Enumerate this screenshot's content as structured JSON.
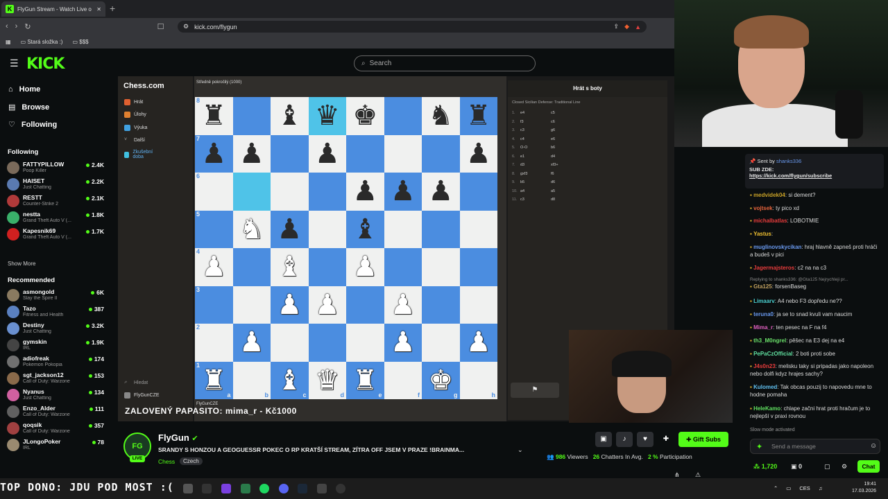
{
  "browser": {
    "tab_title": "FlyGun Stream - Watch Live o",
    "new_tab": "+",
    "url": "kick.com/flygun",
    "bookmarks": [
      "Stará složka :)",
      "$$$"
    ]
  },
  "kick": {
    "logo": "KICK",
    "search_placeholder": "Search"
  },
  "nav": [
    {
      "label": "Home",
      "icon": "home-icon"
    },
    {
      "label": "Browse",
      "icon": "browse-icon"
    },
    {
      "label": "Following",
      "icon": "heart-icon"
    }
  ],
  "following": {
    "title": "Following",
    "show_more": "Show More",
    "channels": [
      {
        "name": "FATTYPILLOW",
        "game": "Poop Killer",
        "viewers": "2.4K",
        "color": "#7a6a5a"
      },
      {
        "name": "HAISET",
        "game": "Just Chatting",
        "viewers": "2.2K",
        "color": "#5a7ab0"
      },
      {
        "name": "RESTT",
        "game": "Counter-Strike 2",
        "viewers": "2.1K",
        "color": "#b03a3a"
      },
      {
        "name": "nestta",
        "game": "Grand Theft Auto V (...",
        "viewers": "1.8K",
        "color": "#3ab06a"
      },
      {
        "name": "Kapesnik69",
        "game": "Grand Theft Auto V (...",
        "viewers": "1.7K",
        "color": "#d02020"
      }
    ]
  },
  "recommended": {
    "title": "Recommended",
    "channels": [
      {
        "name": "asmongold",
        "game": "Slay the Spire II",
        "viewers": "6K",
        "color": "#8a7a60"
      },
      {
        "name": "Tazo",
        "game": "Fitness and Health",
        "viewers": "387",
        "color": "#5a80c0"
      },
      {
        "name": "Destiny",
        "game": "Just Chatting",
        "viewers": "3.2K",
        "color": "#6a90d0"
      },
      {
        "name": "gymskin",
        "game": "IRL",
        "viewers": "1.9K",
        "color": "#444444"
      },
      {
        "name": "adiofreak",
        "game": "Pokemon Pokopia",
        "viewers": "174",
        "color": "#707070"
      },
      {
        "name": "sgt_jackson12",
        "game": "Call of Duty: Warzone",
        "viewers": "153",
        "color": "#8a6a4a"
      },
      {
        "name": "Nyanus",
        "game": "Just Chatting",
        "viewers": "134",
        "color": "#d060a0"
      },
      {
        "name": "Enzo_Alder",
        "game": "Call of Duty: Warzone",
        "viewers": "111",
        "color": "#606060"
      },
      {
        "name": "qoqsik",
        "game": "Call of Duty: Warzone",
        "viewers": "357",
        "color": "#a04040"
      },
      {
        "name": "JLongoPoker",
        "game": "IRL",
        "viewers": "78",
        "color": "#9a8a70"
      }
    ]
  },
  "chess": {
    "logo": "Chess.com",
    "menu": [
      "Hrát",
      "Úlohy",
      "Výuka",
      "Další",
      "Zkušební doba"
    ],
    "bottom": [
      "Hledat",
      "FlyGunCZE"
    ],
    "opponent": "Středně pokročilý (1000)",
    "panel_title": "Hrát s boty",
    "opening": "Closed Sicilian Defense: Traditional Line",
    "player": "FlyGunCZE",
    "moves": [
      [
        "1.",
        "e4",
        "c5"
      ],
      [
        "2.",
        "f3",
        "c6"
      ],
      [
        "3.",
        "c3",
        "g6"
      ],
      [
        "4.",
        "c4",
        "e6"
      ],
      [
        "5.",
        "O-O",
        "b6"
      ],
      [
        "6.",
        "e1",
        "d4"
      ],
      [
        "7.",
        "d3",
        "xf3+"
      ],
      [
        "8.",
        "gxf3",
        "f6"
      ],
      [
        "9.",
        "b5",
        "d6"
      ],
      [
        "10.",
        "a4",
        "a5"
      ],
      [
        "11.",
        "c3",
        "d8"
      ]
    ],
    "ranks": [
      "8",
      "7",
      "6",
      "5",
      "4",
      "3",
      "2",
      "1"
    ],
    "files": [
      "a",
      "b",
      "c",
      "d",
      "e",
      "f",
      "g",
      "h"
    ],
    "position": [
      [
        "bR",
        "",
        "bB",
        "bQ",
        "bK",
        "",
        "bN",
        "bR"
      ],
      [
        "bP",
        "bP",
        "",
        "bP",
        "",
        "",
        "",
        "bP"
      ],
      [
        "",
        "",
        "",
        "",
        "bP",
        "bP",
        "bP",
        ""
      ],
      [
        "",
        "wN",
        "bP",
        "",
        "bB",
        "",
        "",
        ""
      ],
      [
        "wP",
        "",
        "wB",
        "",
        "wP",
        "",
        "",
        ""
      ],
      [
        "",
        "",
        "wP",
        "wP",
        "",
        "wP",
        "",
        ""
      ],
      [
        "",
        "wP",
        "",
        "",
        "",
        "wP",
        "",
        "wP"
      ],
      [
        "wR",
        "",
        "wB",
        "wQ",
        "wR",
        "",
        "wK",
        ""
      ]
    ],
    "highlight": [
      [
        0,
        3
      ],
      [
        2,
        1
      ]
    ]
  },
  "overlay_text": "ZALOVENÝ PAPASITO: mima_r - Kč1000",
  "stream": {
    "name": "FlyGun",
    "avatar": "FG",
    "live": "LIVE",
    "title": "SRANDY S HONZOU A GEOGUESSR  POKEC O RP  KRATŠÍ STREAM, ZÍTRA OFF JSEM V PRAZE  !BRAINMA...",
    "category": "Chess",
    "language": "Czech",
    "gift_label": "Gift Subs",
    "viewers": "986",
    "viewers_label": "Viewers",
    "chatters": "26",
    "chatters_label": "Chatters In Avg.",
    "participation": "2 %",
    "participation_label": "Participation"
  },
  "chat": {
    "pinned_by": "Sent by",
    "pinned_user": "shanks336",
    "pinned_text": "SUB ZDE:",
    "pinned_link": "https://kick.com/flygun/subscribe",
    "messages": [
      {
        "user": "medvidek04",
        "color": "#c9a227",
        "text": "si dement?"
      },
      {
        "user": "vojtsek",
        "color": "#e8643c",
        "text": "ty pico xd"
      },
      {
        "user": "michalbatlas",
        "color": "#e83c3c",
        "text": "LOBOTMIE"
      },
      {
        "user": "Yastus",
        "color": "#f0c030",
        "text": ""
      },
      {
        "user": "muglinovskycikan",
        "color": "#6a9af0",
        "text": "hraj hlavně zapneš proti hráči a budeš v pici"
      },
      {
        "user": "Jagermajsteros",
        "color": "#e83c3c",
        "text": "c2 na na c3"
      },
      {
        "user": "Gta125",
        "color": "#c0a060",
        "text": "forsenBaseg"
      },
      {
        "user": "Limaarv",
        "color": "#4ad0d0",
        "text": "A4 nebo F3 dopředu ne??"
      },
      {
        "user": "teruna0",
        "color": "#6a9af0",
        "text": "ja se to snad kvuli vam naucim"
      },
      {
        "user": "Mima_r",
        "color": "#e060c0",
        "text": "ten pesec na F na f4"
      },
      {
        "user": "th3_M0ngrel",
        "color": "#6ae06a",
        "text": "pěšec na E3 dej na e4"
      },
      {
        "user": "PePaCzOfficial",
        "color": "#60e0a0",
        "text": "2 boti proti sobe"
      },
      {
        "user": "J4s0n23",
        "color": "#e83c3c",
        "text": "melisku taky si pripadas jako napoleon nebo dolfi kdyz hrajes sachy?"
      },
      {
        "user": "Kulomed",
        "color": "#60c0f0",
        "text": "Tak obcas pouzij to napovedu mne to hodne pomaha"
      },
      {
        "user": "HeleKamo",
        "color": "#60e060",
        "text": "chlape začni hrat proti hračum je to nejlepší v praxi rovnou"
      }
    ],
    "reply_note": "Replying to shanks336: @Gta125 Nejrychleji pr...",
    "slow_mode": "Slow mode activated",
    "input_placeholder": "Send a message",
    "points": "1,720",
    "zero": "0",
    "chat_button": "Chat"
  },
  "taskbar": {
    "top_dono": "TOP DONO: JDU POD MOST :(",
    "lang": "CES",
    "time": "19:41",
    "date": "17.03.2026"
  }
}
